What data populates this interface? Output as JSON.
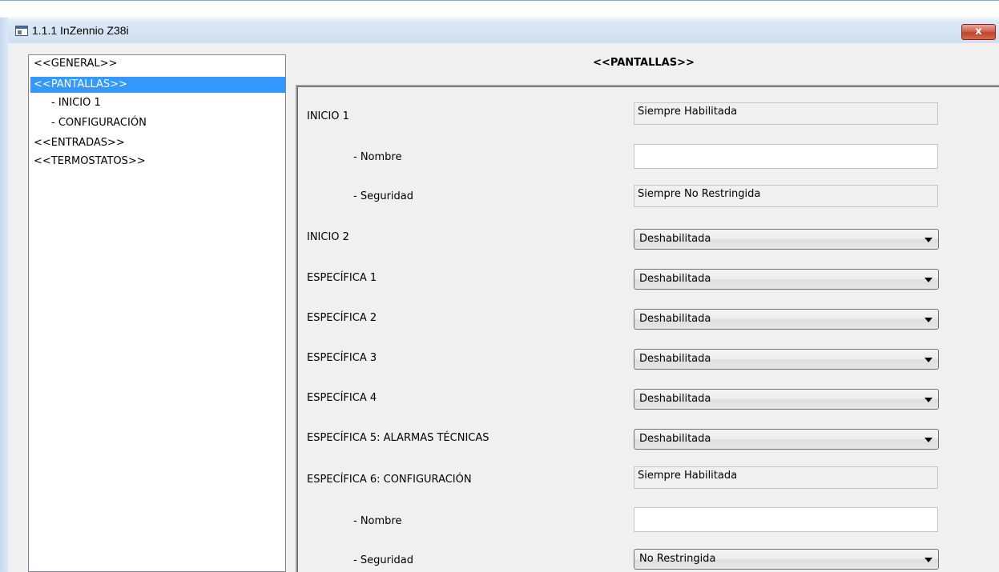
{
  "window": {
    "title": "1.1.1 InZennio Z38i",
    "close_label": "x"
  },
  "tree": {
    "items": [
      {
        "label": "<<GENERAL>>"
      },
      {
        "label": "<<PANTALLAS>>"
      },
      {
        "label": "- INICIO 1"
      },
      {
        "label": "- CONFIGURACIÓN"
      },
      {
        "label": "<<ENTRADAS>>"
      },
      {
        "label": "<<TERMOSTATOS>>"
      }
    ],
    "selected_index": 1
  },
  "section": {
    "title": "<<PANTALLAS>>"
  },
  "params": {
    "inicio1": {
      "label": "INICIO 1",
      "value": "Siempre Habilitada"
    },
    "inicio1_nombre": {
      "label": "- Nombre",
      "value": ""
    },
    "inicio1_seguridad": {
      "label": "- Seguridad",
      "value": "Siempre No Restringida"
    },
    "inicio2": {
      "label": "INICIO 2",
      "value": "Deshabilitada"
    },
    "esp1": {
      "label": "ESPECÍFICA 1",
      "value": "Deshabilitada"
    },
    "esp2": {
      "label": "ESPECÍFICA 2",
      "value": "Deshabilitada"
    },
    "esp3": {
      "label": "ESPECÍFICA 3",
      "value": "Deshabilitada"
    },
    "esp4": {
      "label": "ESPECÍFICA 4",
      "value": "Deshabilitada"
    },
    "esp5": {
      "label": "ESPECÍFICA 5: ALARMAS TÉCNICAS",
      "value": "Deshabilitada"
    },
    "esp6": {
      "label": "ESPECÍFICA 6: CONFIGURACIÓN",
      "value": "Siempre Habilitada"
    },
    "esp6_nombre": {
      "label": "- Nombre",
      "value": ""
    },
    "esp6_seguridad": {
      "label": "- Seguridad",
      "value": "No Restringida"
    }
  }
}
